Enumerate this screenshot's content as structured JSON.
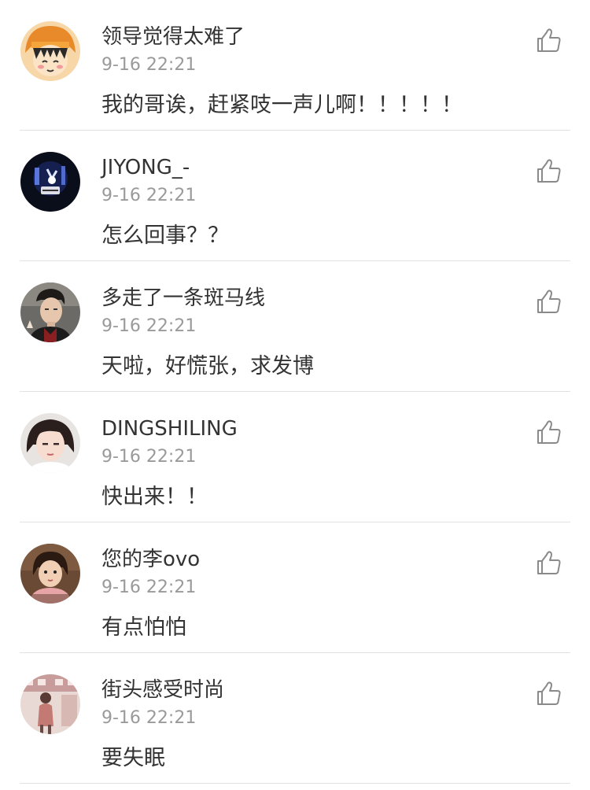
{
  "comments": [
    {
      "username": "领导觉得太难了",
      "time": "9-16 22:21",
      "text": "我的哥诶，赶紧吱一声儿啊！！！！！",
      "avatar_icon": "cartoon-girl-avatar"
    },
    {
      "username": "JIYONG_-",
      "time": "9-16 22:21",
      "text": "怎么回事？？",
      "avatar_icon": "dark-night-avatar"
    },
    {
      "username": "多走了一条斑马线",
      "time": "9-16 22:21",
      "text": "天啦，好慌张，求发博",
      "avatar_icon": "man-portrait-avatar"
    },
    {
      "username": "DINGSHILING",
      "time": "9-16 22:21",
      "text": "快出来！！",
      "avatar_icon": "woman-portrait-avatar"
    },
    {
      "username": "您的李ovo",
      "time": "9-16 22:21",
      "text": "有点怕怕",
      "avatar_icon": "child-portrait-avatar"
    },
    {
      "username": "街头感受时尚",
      "time": "9-16 22:21",
      "text": "要失眠",
      "avatar_icon": "street-photo-avatar"
    }
  ],
  "icons": {
    "like": "thumbs-up-icon"
  },
  "colors": {
    "text": "#333333",
    "timestamp": "#9a9a9a",
    "divider": "#e2e2e2",
    "icon": "#8a8a8a"
  }
}
